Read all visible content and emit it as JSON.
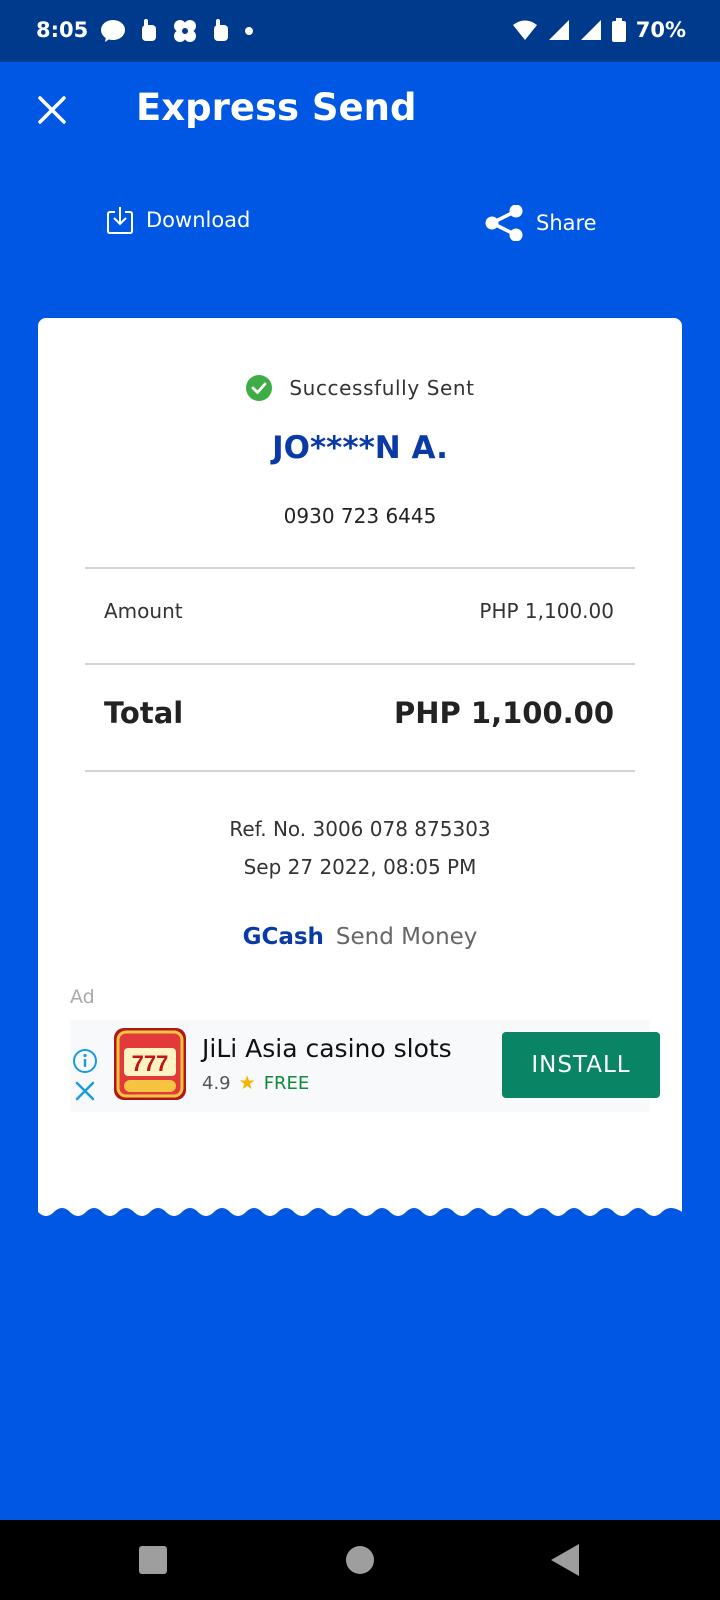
{
  "status_bar": {
    "time": "8:05",
    "battery": "70%"
  },
  "header": {
    "title": "Express Send"
  },
  "actions": {
    "download_label": "Download",
    "share_label": "Share"
  },
  "receipt": {
    "status": "Successfully Sent",
    "recipient_name": "JO****N A.",
    "recipient_phone": "0930 723 6445",
    "amount_label": "Amount",
    "amount_value": "PHP 1,100.00",
    "total_label": "Total",
    "total_value": "PHP 1,100.00",
    "ref_no": "Ref. No. 3006 078 875303",
    "datetime": "Sep 27 2022, 08:05 PM",
    "brand_name": "GCash",
    "brand_service": "Send Money"
  },
  "ad": {
    "label": "Ad",
    "app_name": "JiLi Asia casino slots",
    "rating": "4.9",
    "price": "FREE",
    "install_label": "INSTALL",
    "icon_text": "777"
  },
  "colors": {
    "primary": "#0057e4",
    "status_bar": "#003a8c",
    "success": "#3fad46",
    "install": "#098464",
    "brand_blue": "#0a3aa6"
  }
}
